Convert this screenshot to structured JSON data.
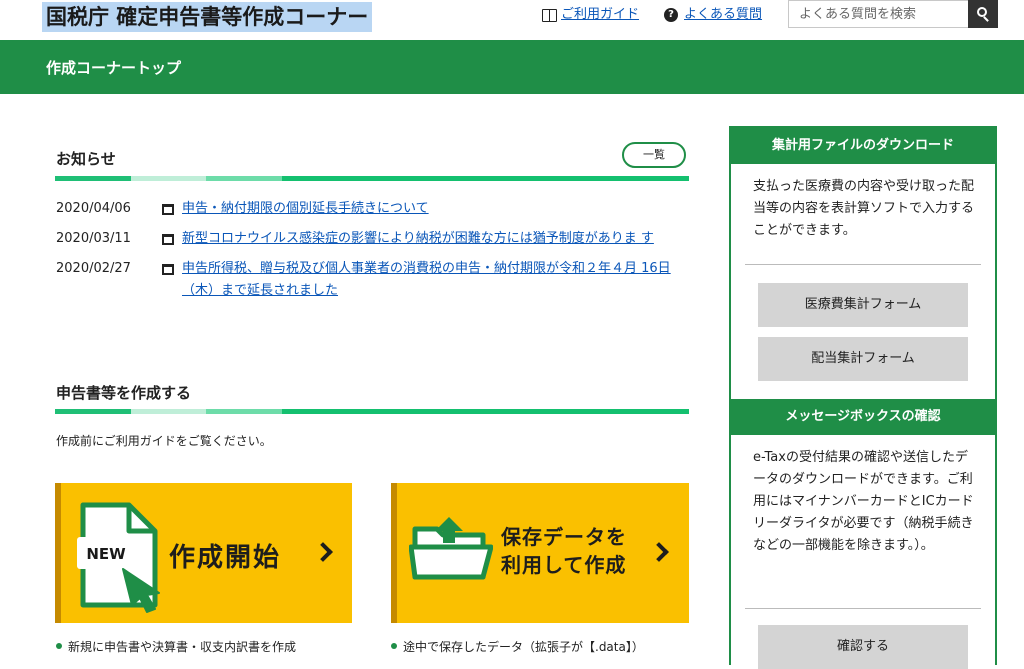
{
  "header": {
    "site_title": "国税庁 確定申告書等作成コーナー",
    "guide_link": "ご利用ガイド",
    "faq_link": "よくある質問",
    "faq_icon_glyph": "?",
    "search_placeholder": "よくある質問を検索"
  },
  "nav": {
    "title": "作成コーナートップ"
  },
  "news": {
    "heading": "お知らせ",
    "all_button": "一覧",
    "items": [
      {
        "date": "2020/04/06",
        "text": "申告・納付期限の個別延長手続きについて"
      },
      {
        "date": "2020/03/11",
        "text": "新型コロナウイルス感染症の影響により納税が困難な方には猶予制度がありま す"
      },
      {
        "date": "2020/02/27",
        "text": "申告所得税、贈与税及び個人事業者の消費税の申告・納付期限が令和２年４月 16日（木）まで延長されました"
      }
    ]
  },
  "create": {
    "heading": "申告書等を作成する",
    "note": "作成前にご利用ガイドをご覧ください。",
    "card_new": {
      "badge": "NEW",
      "label": "作成開始"
    },
    "card_saved": {
      "label_line1": "保存データを",
      "label_line2": "利用して作成"
    },
    "caption_new": "新規に申告書や決算書・収支内訳書を作成",
    "caption_saved": "途中で保存したデータ（拡張子が【.data】）"
  },
  "sidebar": {
    "download": {
      "heading": "集計用ファイルのダウンロード",
      "text": "支払った医療費の内容や受け取った配当等の内容を表計算ソフトで入力することができます。",
      "button_medical": "医療費集計フォーム",
      "button_dividend": "配当集計フォーム"
    },
    "messagebox": {
      "heading": "メッセージボックスの確認",
      "text": "e-Taxの受付結果の確認や送信したデータのダウンロードができます。ご利用にはマイナンバーカードとICカードリーダライタが必要です（納税手続きなどの一部機能を除きます。）。",
      "button_confirm": "確認する"
    }
  },
  "colors": {
    "brand_green": "#1f8e47",
    "card_yellow": "#fac000",
    "link_blue": "#0a56b8",
    "title_highlight": "#b9d6f3"
  }
}
